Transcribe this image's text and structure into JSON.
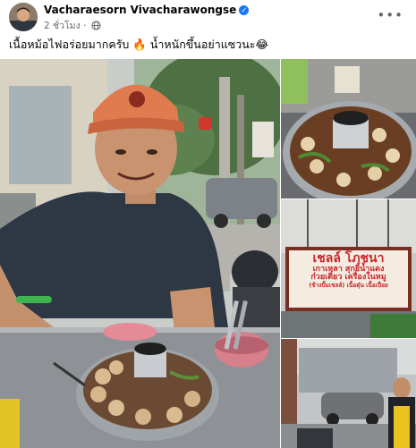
{
  "post": {
    "author": "Vacharaesorn Vivacharawongse",
    "time": "2 ชั่วโมง",
    "caption": "เนื้อหม้อไฟอร่อยมากครับ 🔥 น้ำหนักขึ้นอย่าแซวนะ😂",
    "more_icon": "more-options-icon",
    "privacy_icon": "globe-icon"
  },
  "photos": {
    "shop_sign": {
      "line1": "เชลล์ โภชนา",
      "line2": "เกาเหลา สุกยี้น้ำแดง",
      "line3": "ก๋วยเตี๋ยว เครื่องในหมู",
      "line4": "(ข้างปั๊มเชลล์) เนื้อตุ๋น เนื้อเปื่อย"
    }
  },
  "colors": {
    "verified": "#1877f2",
    "meta": "#65676b",
    "sign_red": "#c8262c"
  }
}
